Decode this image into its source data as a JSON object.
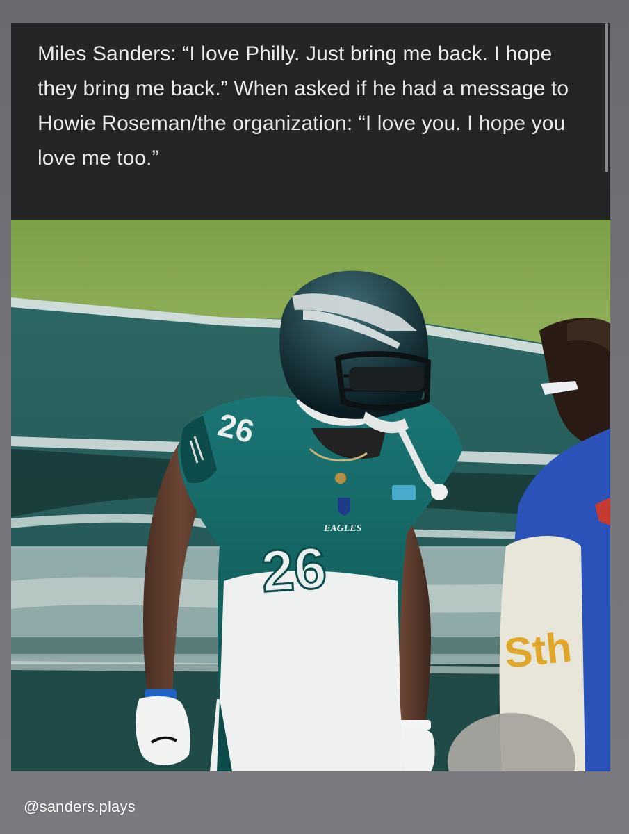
{
  "tweet": {
    "text": "Miles Sanders: “I love Philly. Just bring me back. I hope they bring me back.” When asked if he had a message to Howie Roseman/the organization: “I love you. I hope you love me too.”"
  },
  "photo": {
    "jersey_number": "26",
    "chest_lettering": "EAGLES"
  },
  "footer": {
    "handle": "@sanders.plays"
  },
  "colors": {
    "background": "#6e6e74",
    "tweet_card": "#242526",
    "tweet_text": "#e7e9ea",
    "eagles_midnight_green": "#0b5f5c",
    "field_grass": "#86a84e"
  }
}
